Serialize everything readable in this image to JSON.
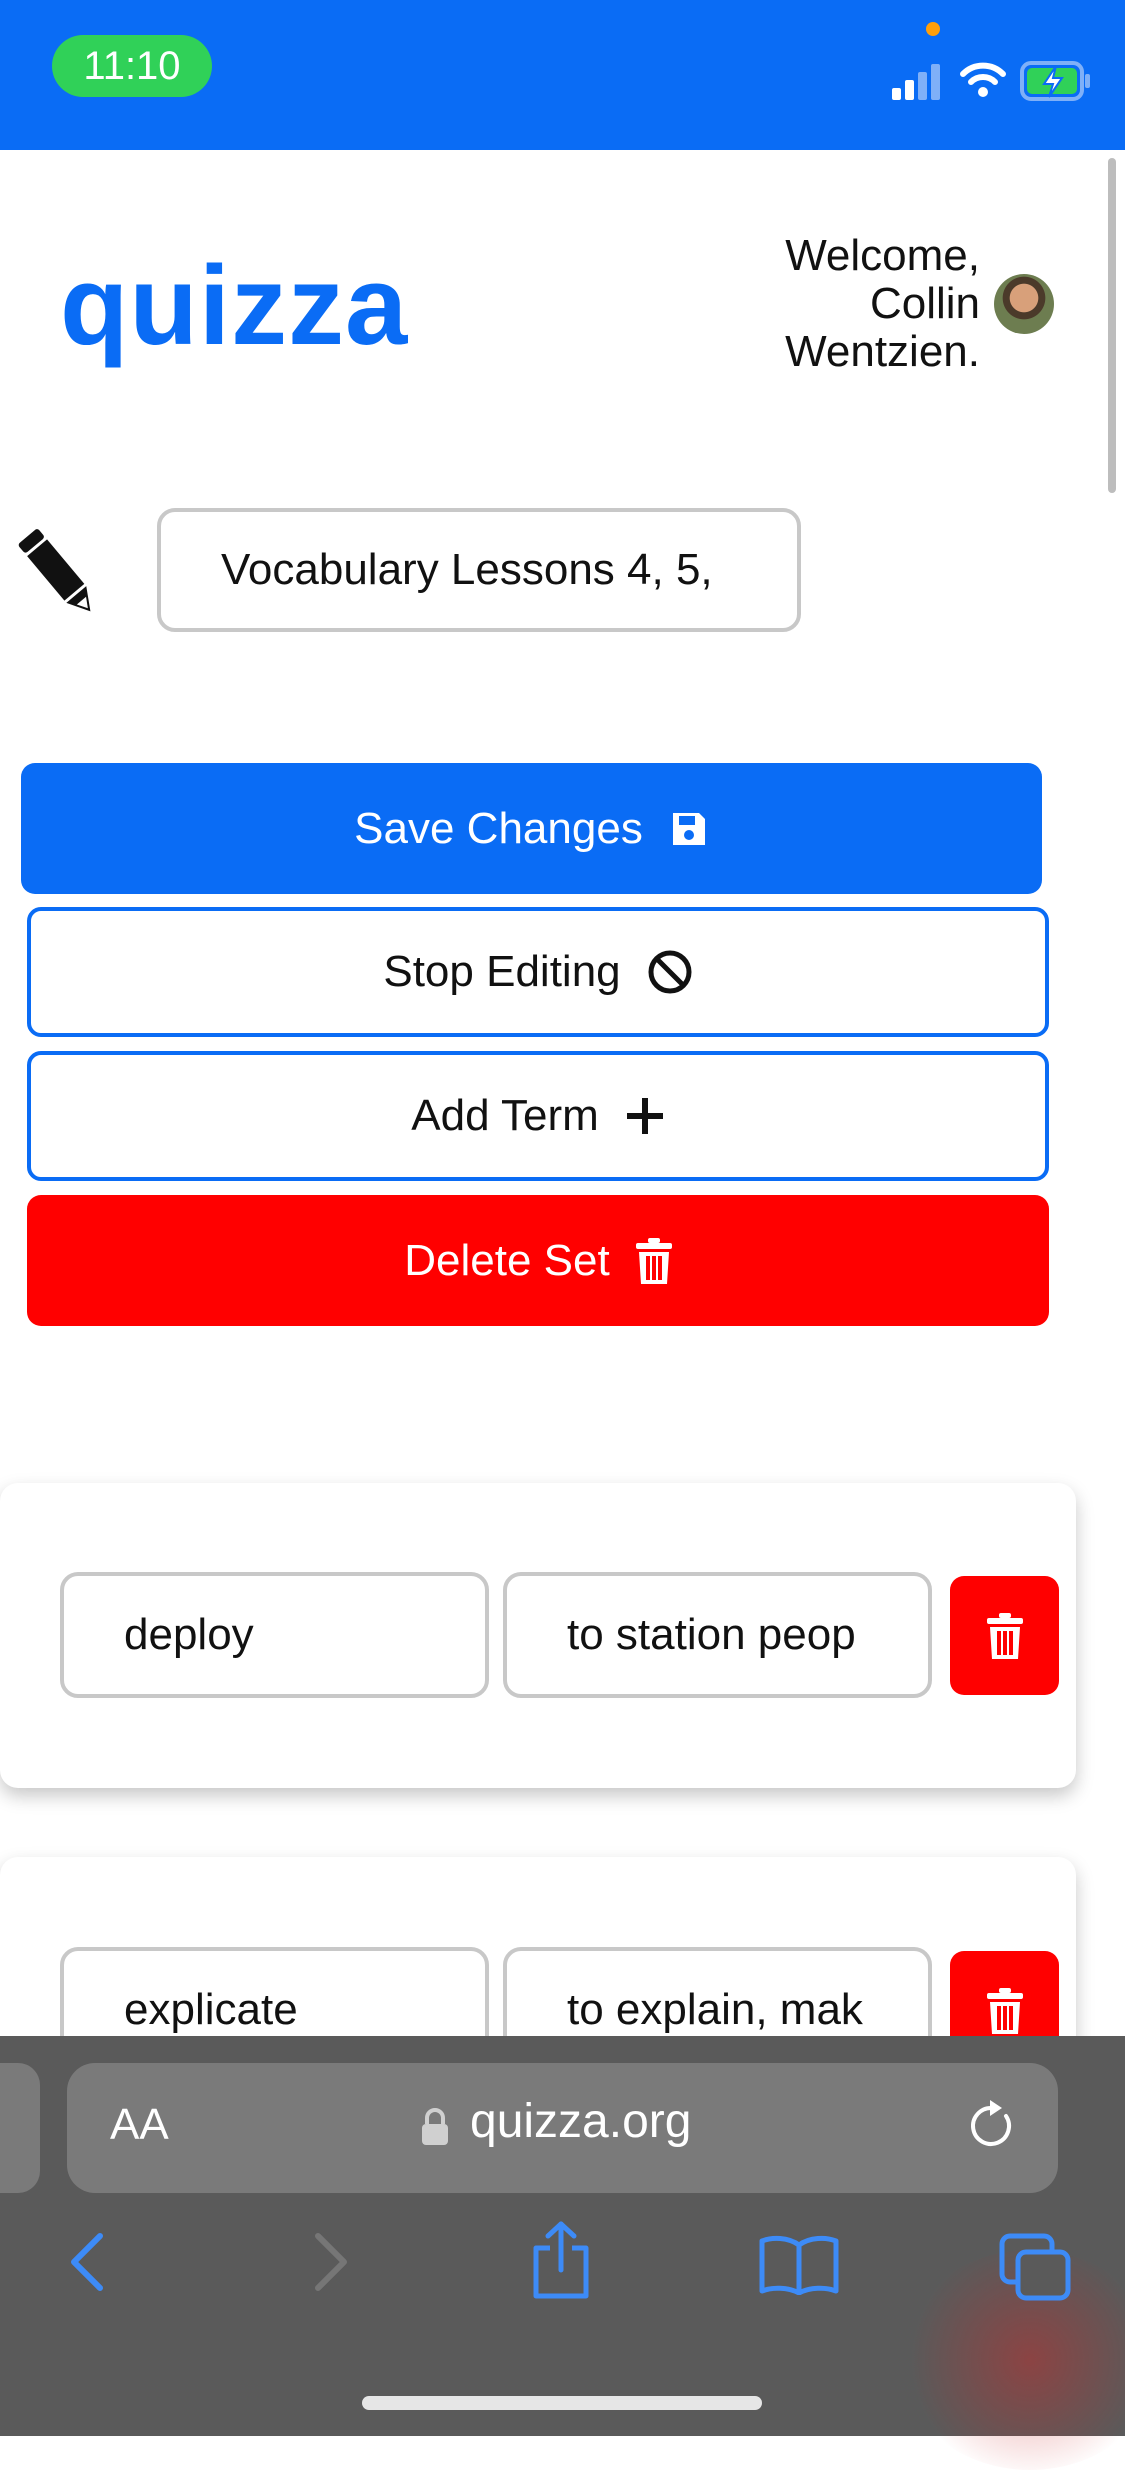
{
  "status_bar": {
    "time": "11:10",
    "icons": [
      "cellular-signal-icon",
      "wifi-icon",
      "battery-charging-icon"
    ],
    "background_color": "#0a6cf5",
    "time_pill_color": "#30d158"
  },
  "header": {
    "logo_text": "quizza",
    "welcome_line1": "Welcome,",
    "welcome_line2": "Collin",
    "welcome_line3": "Wentzien.",
    "brand_color": "#0a6cf5"
  },
  "set_editor": {
    "title_value": "Vocabulary Lessons 4, 5,",
    "title_icon": "pencil-icon"
  },
  "actions": {
    "save_label": "Save Changes",
    "save_icon": "floppy-disk-icon",
    "stop_label": "Stop Editing",
    "stop_icon": "ban-icon",
    "add_label": "Add Term",
    "add_icon": "plus-icon",
    "delete_label": "Delete Set",
    "delete_icon": "trash-icon",
    "delete_color": "#ff0000"
  },
  "terms": [
    {
      "term": "deploy",
      "definition": "to station peop"
    },
    {
      "term": "explicate",
      "definition": "to explain, mak"
    }
  ],
  "browser": {
    "aa_label": "AA",
    "url": "quizza.org",
    "icons": [
      "lock-icon",
      "reload-icon",
      "back-icon",
      "forward-icon",
      "share-icon",
      "bookmarks-icon",
      "tabs-icon"
    ]
  }
}
